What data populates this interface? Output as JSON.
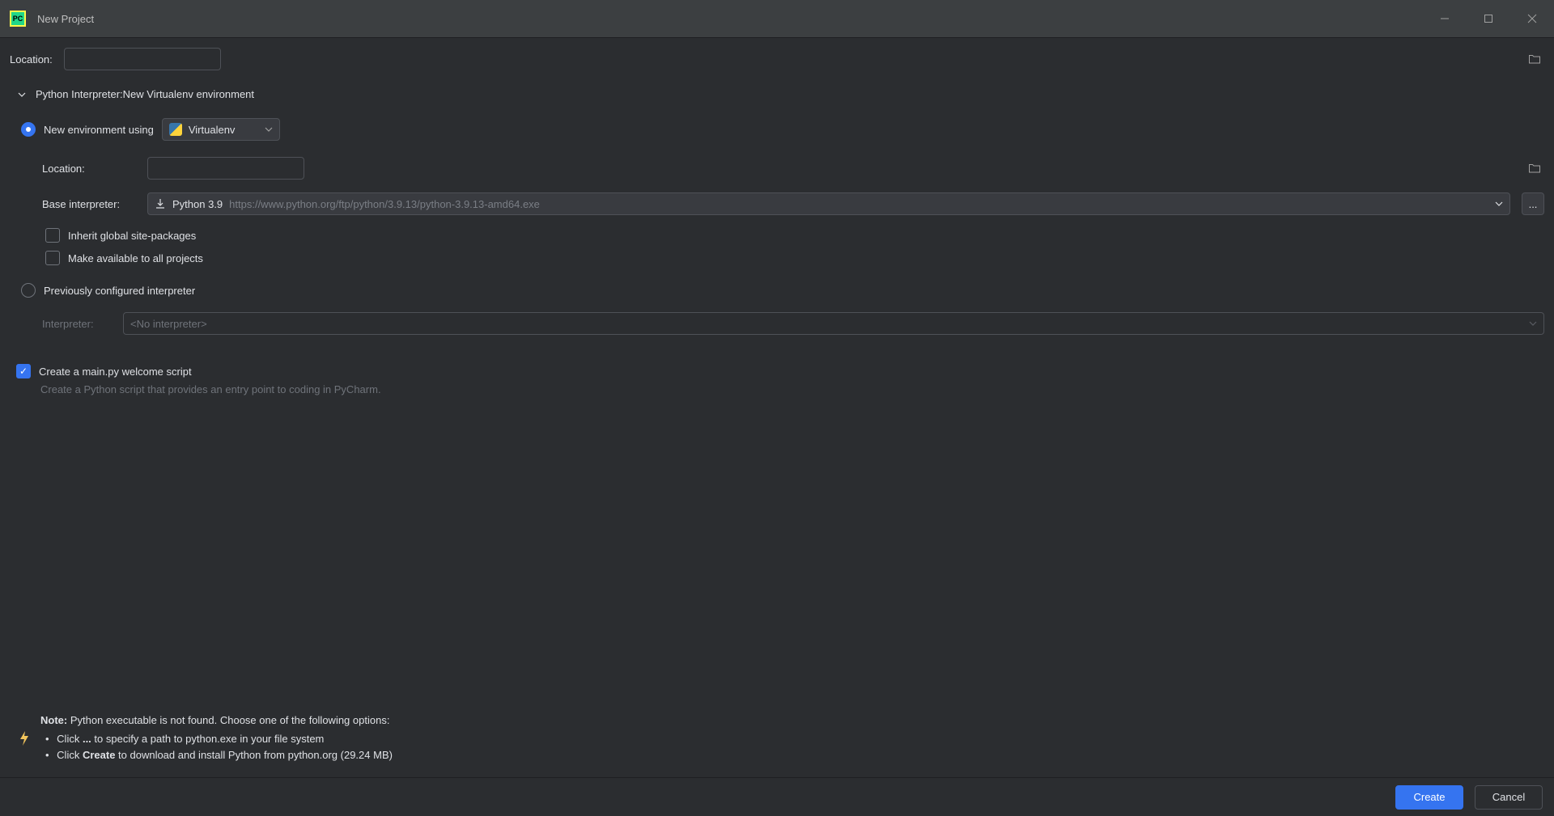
{
  "window": {
    "title": "New Project"
  },
  "location": {
    "label": "Location:",
    "value": ""
  },
  "interpreter_section": {
    "header_prefix": "Python Interpreter: ",
    "header_value": "New Virtualenv environment"
  },
  "new_env": {
    "radio_label": "New environment using",
    "selected_tool": "Virtualenv",
    "location_label": "Location:",
    "location_value": "",
    "base_label": "Base interpreter:",
    "base_selected_main": "Python 3.9",
    "base_selected_sub": "https://www.python.org/ftp/python/3.9.13/python-3.9.13-amd64.exe",
    "inherit_label": "Inherit global site-packages",
    "inherit_checked": false,
    "make_avail_label": "Make available to all projects",
    "make_avail_checked": false
  },
  "prev_interp": {
    "radio_label": "Previously configured interpreter",
    "field_label": "Interpreter:",
    "value": "<No interpreter>"
  },
  "welcome": {
    "checked": true,
    "label": "Create a main.py welcome script",
    "desc": "Create a Python script that provides an entry point to coding in PyCharm."
  },
  "note": {
    "note_word": "Note:",
    "note_rest": " Python executable is not found. Choose one of the following options:",
    "b1_pre": "Click ",
    "b1_bold": "...",
    "b1_post": " to specify a path to python.exe in your file system",
    "b2_pre": "Click ",
    "b2_bold": "Create",
    "b2_post": " to download and install Python from python.org (29.24 MB)"
  },
  "footer": {
    "create": "Create",
    "cancel": "Cancel"
  }
}
